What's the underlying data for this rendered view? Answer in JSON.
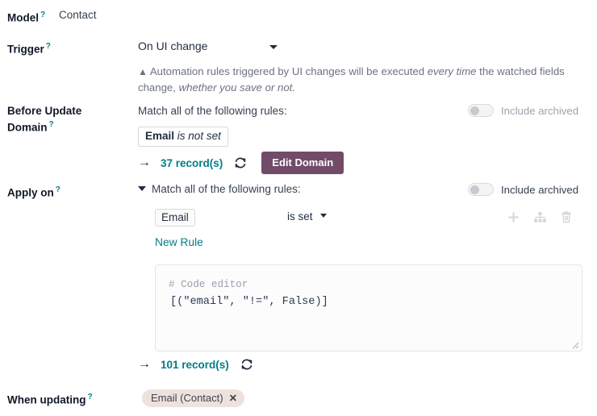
{
  "fields": {
    "model": {
      "label": "Model",
      "help_marker": "?",
      "value": "Contact"
    },
    "trigger": {
      "label": "Trigger",
      "help_marker": "?",
      "value": "On UI change",
      "warning": {
        "icon": "warning-triangle-icon",
        "text_before": "Automation rules triggered by UI changes will be executed ",
        "emphasis_1": "every time",
        "text_middle": " the watched fields change, ",
        "emphasis_2": "whether you save or not."
      }
    },
    "before_update_domain": {
      "label_line1": "Before Update",
      "label_line2": "Domain",
      "help_marker": "?",
      "match_text": "Match all of the following rules:",
      "facet": {
        "field": "Email",
        "operator": "is not set"
      },
      "record_count": "37 record(s)",
      "arrow": "→",
      "refresh_icon": "refresh-icon",
      "edit_button": "Edit Domain",
      "include_archived": "Include archived",
      "toggle_state": "off"
    },
    "apply_on": {
      "label": "Apply on",
      "help_marker": "?",
      "match_text": "Match all of the following rules:",
      "caret": "expanded",
      "rule": {
        "field": "Email",
        "operator": "is set"
      },
      "node_icons": [
        "plus-icon",
        "branch-icon",
        "trash-icon"
      ],
      "new_rule_link": "New Rule",
      "code_editor": {
        "placeholder_comment": "# Code editor",
        "code": "[(\"email\", \"!=\", False)]"
      },
      "record_count": "101 record(s)",
      "arrow": "→",
      "refresh_icon": "refresh-icon",
      "include_archived": "Include archived",
      "toggle_state": "off"
    },
    "when_updating": {
      "label": "When updating",
      "help_marker": "?",
      "tags": [
        {
          "text": "Email (Contact)",
          "remove": "✕"
        }
      ]
    }
  },
  "colors": {
    "primary": "#714b67",
    "link": "#017e84",
    "text": "#1f2d3d",
    "muted": "#9ca3af",
    "tag_bg": "#eee2dd"
  }
}
